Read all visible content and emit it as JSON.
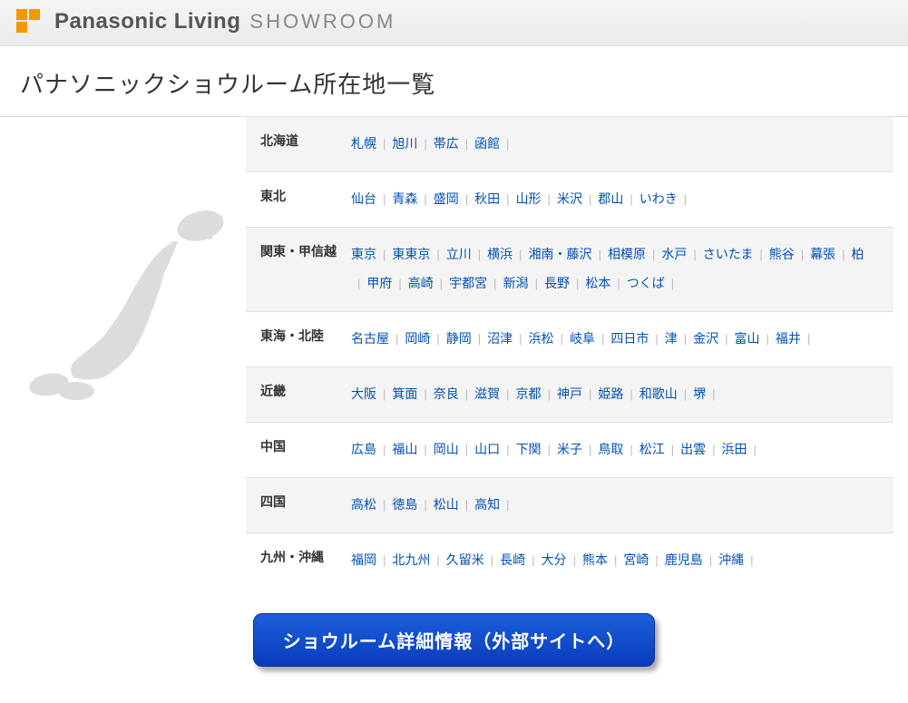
{
  "header": {
    "brand_main": "Panasonic Living",
    "brand_sub": "SHOWROOM"
  },
  "page_title": "パナソニックショウルーム所在地一覧",
  "regions": [
    {
      "name": "北海道",
      "cities": [
        "札幌",
        "旭川",
        "帯広",
        "函館"
      ]
    },
    {
      "name": "東北",
      "cities": [
        "仙台",
        "青森",
        "盛岡",
        "秋田",
        "山形",
        "米沢",
        "郡山",
        "いわき"
      ]
    },
    {
      "name": "関東・甲信越",
      "cities": [
        "東京",
        "東東京",
        "立川",
        "横浜",
        "湘南・藤沢",
        "相模原",
        "水戸",
        "さいたま",
        "熊谷",
        "幕張",
        "柏",
        "甲府",
        "高崎",
        "宇都宮",
        "新潟",
        "長野",
        "松本",
        "つくば"
      ]
    },
    {
      "name": "東海・北陸",
      "cities": [
        "名古屋",
        "岡崎",
        "静岡",
        "沼津",
        "浜松",
        "岐阜",
        "四日市",
        "津",
        "金沢",
        "富山",
        "福井"
      ]
    },
    {
      "name": "近畿",
      "cities": [
        "大阪",
        "箕面",
        "奈良",
        "滋賀",
        "京都",
        "神戸",
        "姫路",
        "和歌山",
        "堺"
      ]
    },
    {
      "name": "中国",
      "cities": [
        "広島",
        "福山",
        "岡山",
        "山口",
        "下関",
        "米子",
        "鳥取",
        "松江",
        "出雲",
        "浜田"
      ]
    },
    {
      "name": "四国",
      "cities": [
        "高松",
        "徳島",
        "松山",
        "高知"
      ]
    },
    {
      "name": "九州・沖縄",
      "cities": [
        "福岡",
        "北九州",
        "久留米",
        "長崎",
        "大分",
        "熊本",
        "宮崎",
        "鹿児島",
        "沖縄"
      ]
    }
  ],
  "cta_label": "ショウルーム詳細情報（外部サイトへ）"
}
